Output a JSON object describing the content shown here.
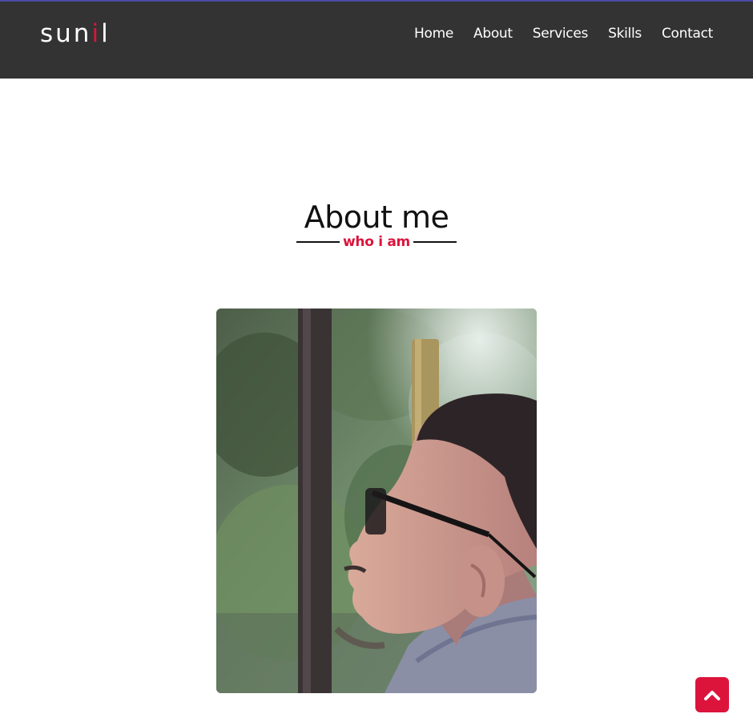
{
  "navbar": {
    "logo_prefix": "sun",
    "logo_accent": "i",
    "logo_suffix": "l",
    "menu": [
      {
        "label": "Home"
      },
      {
        "label": "About"
      },
      {
        "label": "Services"
      },
      {
        "label": "Skills"
      },
      {
        "label": "Contact"
      }
    ]
  },
  "about": {
    "title": "About me",
    "subtitle": "who i am",
    "photo_icon": "profile-photo"
  },
  "scroll_up": {
    "icon": "chevron-up-icon"
  },
  "colors": {
    "accent": "#dc143c",
    "navbar_bg": "#333333",
    "text_dark": "#111111",
    "white": "#ffffff"
  }
}
